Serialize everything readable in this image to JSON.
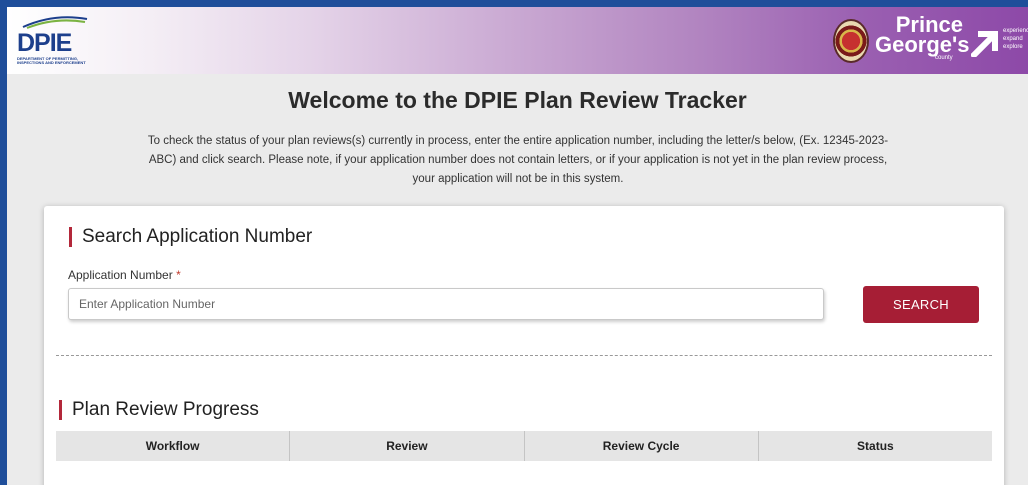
{
  "header": {
    "dpie_logo_text": "DPIE",
    "dpie_logo_subtext": "DEPARTMENT OF PERMITTING, INSPECTIONS AND ENFORCEMENT",
    "pg_line1": "Prince",
    "pg_line2": "George's",
    "pg_county": "county",
    "pg_tagline": "experience expand explore"
  },
  "page": {
    "title": "Welcome to the DPIE Plan Review Tracker",
    "intro": "To check the status of your plan reviews(s) currently in process, enter the entire application number, including the letter/s below, (Ex. 12345-2023-ABC) and click search. Please note, if your application number does not contain letters, or if your application is not yet in the plan review process, your application will not be in this system."
  },
  "search": {
    "section_title": "Search Application Number",
    "field_label": "Application Number",
    "required_mark": "*",
    "value": "",
    "placeholder": "Enter Application Number",
    "button_label": "SEARCH"
  },
  "progress": {
    "section_title": "Plan Review Progress",
    "columns": [
      "Workflow",
      "Review",
      "Review Cycle",
      "Status"
    ]
  },
  "colors": {
    "accent": "#a61e35",
    "frame": "#1f4e9a",
    "banner_end": "#8d49a8"
  }
}
